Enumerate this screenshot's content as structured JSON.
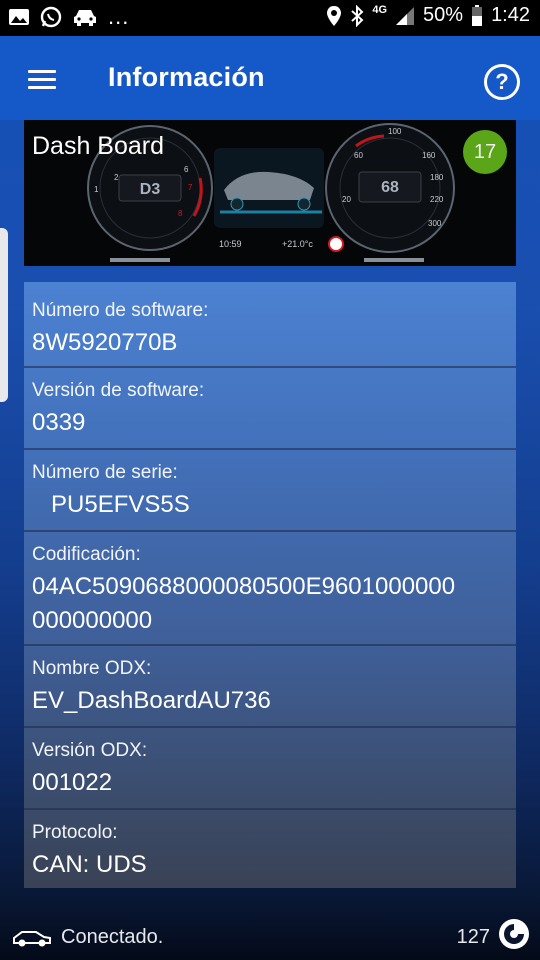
{
  "statusbar": {
    "battery": "50%",
    "time": "1:42",
    "network": "4G",
    "overflow": "..."
  },
  "appbar": {
    "title": "Información"
  },
  "dash": {
    "label": "Dash Board",
    "badge": "17",
    "gauge_left_gear": "D3",
    "gauge_right_speed": "68",
    "time": "10:59",
    "temp": "+21.0°c"
  },
  "info": [
    {
      "label": "Número de software:",
      "value": "8W5920770B"
    },
    {
      "label": "Versión de software:",
      "value": "0339"
    },
    {
      "label": "Número de serie:",
      "value": "PU5EFVS5S"
    },
    {
      "label": "Codificación:",
      "value_line1": "04AC509068800008050​0E9601000000",
      "value_line2": "000000000"
    },
    {
      "label": "Nombre ODX:",
      "value": "EV_DashBoardAU736"
    },
    {
      "label": "Versión ODX:",
      "value": "001022"
    },
    {
      "label": "Protocolo:",
      "value": "CAN: UDS"
    }
  ],
  "bottom": {
    "status": "Conectado.",
    "count": "127"
  },
  "icons": [
    "gallery-icon",
    "whatsapp-icon",
    "car-icon",
    "location-icon",
    "bluetooth-icon",
    "signal-icon",
    "battery-icon",
    "menu-icon",
    "help-icon",
    "car-connected-icon",
    "app-logo-icon"
  ]
}
